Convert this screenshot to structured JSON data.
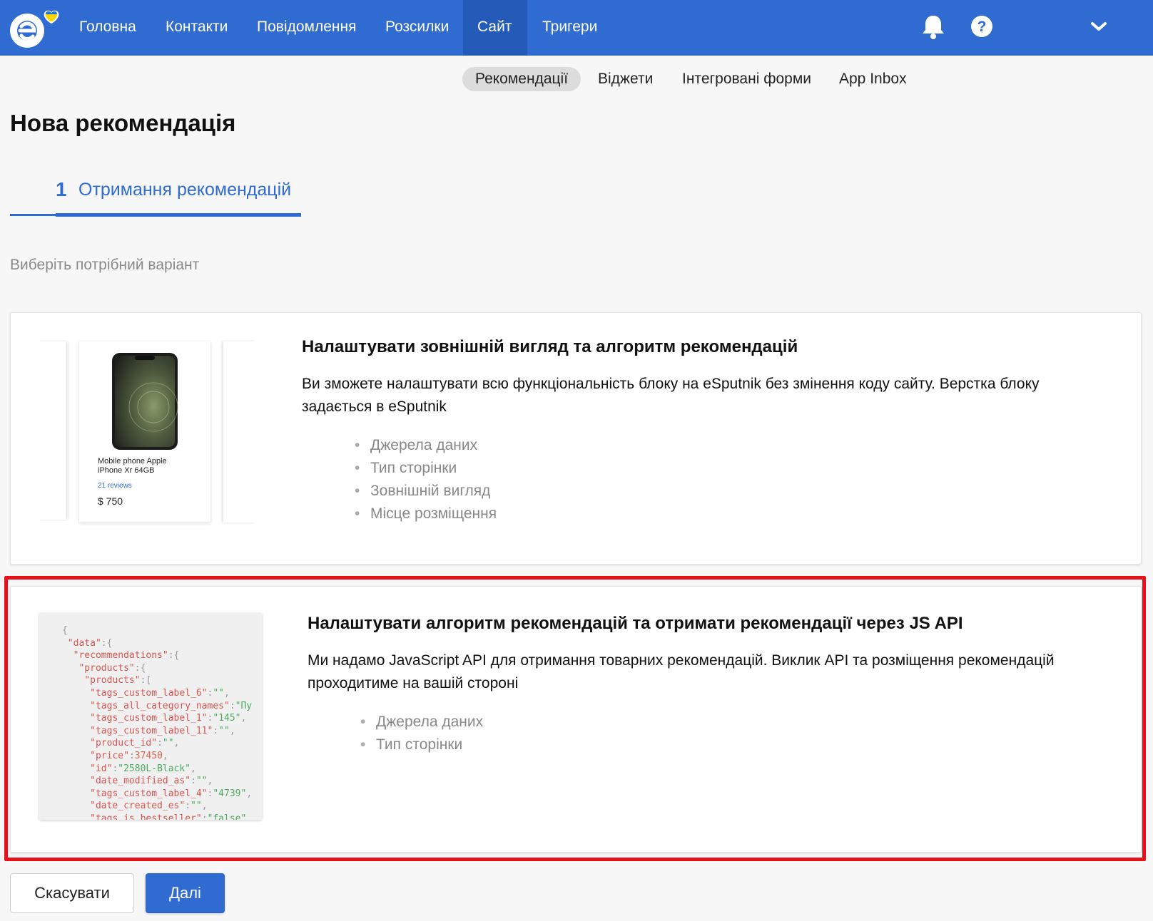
{
  "nav": {
    "items": [
      {
        "label": "Головна"
      },
      {
        "label": "Контакти"
      },
      {
        "label": "Повідомлення"
      },
      {
        "label": "Розсилки"
      },
      {
        "label": "Сайт"
      },
      {
        "label": "Тригери"
      }
    ],
    "active_item": "Сайт",
    "icons": [
      "notification-bell-icon",
      "help-icon",
      "chevron-down-icon"
    ]
  },
  "subnav": {
    "items": [
      {
        "label": "Рекомендації"
      },
      {
        "label": "Віджети"
      },
      {
        "label": "Інтегровані форми"
      },
      {
        "label": "App Inbox"
      }
    ],
    "active_item": "Рекомендації"
  },
  "page": {
    "title": "Нова рекомендація",
    "step": {
      "number": "1",
      "label": "Отримання рекомендацій"
    },
    "hint": "Виберіть потрібний варіант"
  },
  "options": [
    {
      "title": "Налаштувати зовнішній вигляд та алгоритм рекомендацій",
      "description": "Ви зможете налаштувати всю функціональність блоку на eSputnik без змінення коду сайту. Верстка блоку задається в eSputnik",
      "features": [
        "Джерела даних",
        "Тип сторінки",
        "Зовнішній вигляд",
        "Місце розміщення"
      ],
      "preview": {
        "product_name": "Mobile phone Apple iPhone Xr 64GB",
        "reviews": "21 reviews",
        "price": "$ 750"
      }
    },
    {
      "title": "Налаштувати алгоритм рекомендацій та отримати рекомендації через JS API",
      "description": "Ми надамо JavaScript API для отримання товарних рекомендацій. Виклик API та розміщення рекомендацій проходитиме на вашій стороні",
      "features": [
        "Джерела даних",
        "Тип сторінки"
      ],
      "code_preview": [
        "{",
        " \"data\":{",
        "  \"recommendations\":{",
        "   \"products\":{",
        "    \"products\":[",
        "     \"tags_custom_label_6\":\"\",",
        "     \"tags_all_category_names\":\"Пу",
        "     \"tags_custom_label_1\":\"145\",",
        "     \"tags_custom_label_11\":\"\",",
        "     \"product_id\":\"\",",
        "     \"price\":37450,",
        "     \"id\":\"2580L-Black\",",
        "     \"date_modified_as\":\"\",",
        "     \"tags_custom_label_4\":\"4739\",",
        "     \"date_created_es\":\"\",",
        "     \"tags_is_bestseller\":\"false\""
      ],
      "highlighted": true
    }
  ],
  "buttons": {
    "cancel": "Скасувати",
    "next": "Далі"
  },
  "colors": {
    "brand_blue": "#2f6bd0",
    "highlight_red": "#e8101a"
  }
}
